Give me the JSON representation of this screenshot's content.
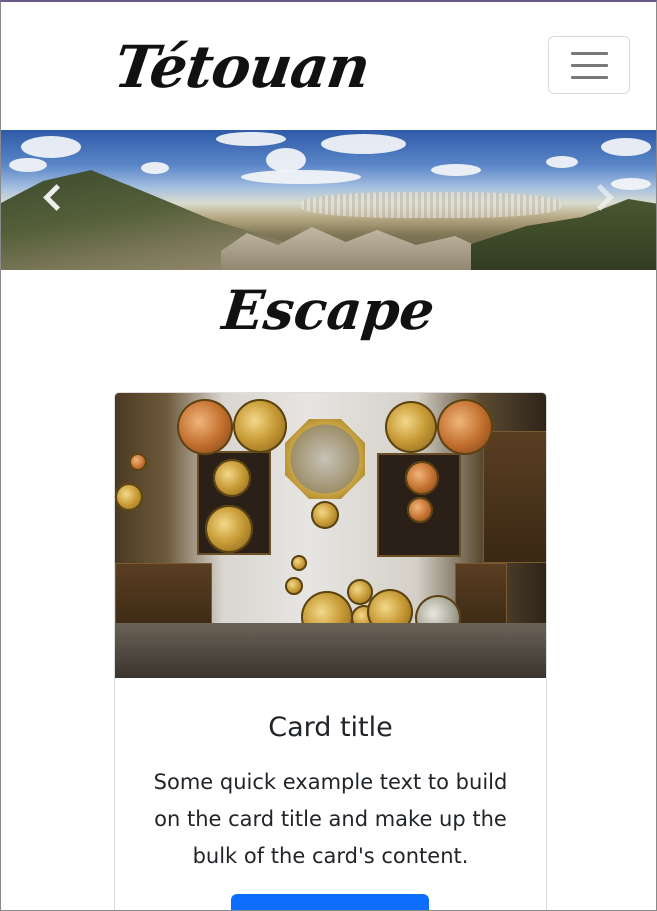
{
  "navbar": {
    "brand": "Tétouan",
    "toggler_icon": "hamburger-menu-icon"
  },
  "carousel": {
    "image_description": "panoramic mountain landscape",
    "prev_icon": "chevron-left-icon",
    "next_icon": "chevron-right-icon"
  },
  "section": {
    "title": "Escape"
  },
  "card": {
    "image_description": "room full of brass and copper plates",
    "title": "Card title",
    "text": "Some quick example text to build on the card title and make up the bulk of the card's content.",
    "button_label": "",
    "button_color": "#0d6efd"
  }
}
